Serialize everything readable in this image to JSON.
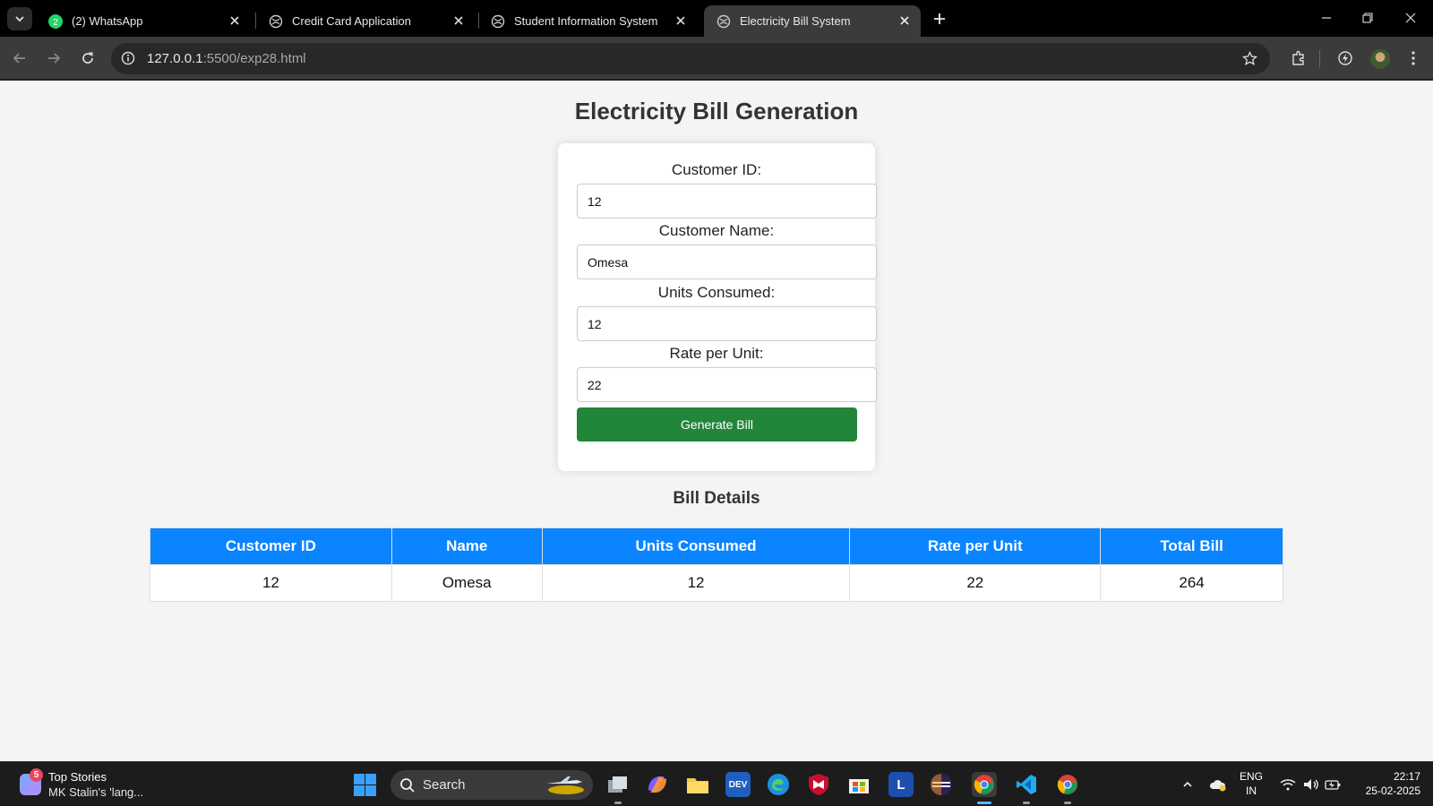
{
  "browser": {
    "tabs": [
      {
        "title": "(2) WhatsApp",
        "badge": "2"
      },
      {
        "title": "Credit Card Application"
      },
      {
        "title": "Student Information System"
      },
      {
        "title": "Electricity Bill System"
      }
    ],
    "url_host": "127.0.0.1",
    "url_path": ":5500/exp28.html"
  },
  "page": {
    "title": "Electricity Bill Generation",
    "form": {
      "customer_id_label": "Customer ID:",
      "customer_id_value": "12",
      "customer_name_label": "Customer Name:",
      "customer_name_value": "Omesa",
      "units_label": "Units Consumed:",
      "units_value": "12",
      "rate_label": "Rate per Unit:",
      "rate_value": "22",
      "button_label": "Generate Bill"
    },
    "bill": {
      "heading": "Bill Details",
      "headers": [
        "Customer ID",
        "Name",
        "Units Consumed",
        "Rate per Unit",
        "Total Bill"
      ],
      "rows": [
        [
          "12",
          "Omesa",
          "12",
          "22",
          "264"
        ]
      ]
    }
  },
  "taskbar": {
    "news_badge": "5",
    "news_title": "Top Stories",
    "news_sub": "MK Stalin's 'lang...",
    "search_label": "Search",
    "dev_label": "DEV",
    "l_label": "L",
    "lang_line1": "ENG",
    "lang_line2": "IN",
    "time": "22:17",
    "date": "25-02-2025"
  },
  "colors": {
    "generate_button": "#22863a",
    "table_header": "#0a84ff",
    "page_background": "#f4f4f4"
  }
}
